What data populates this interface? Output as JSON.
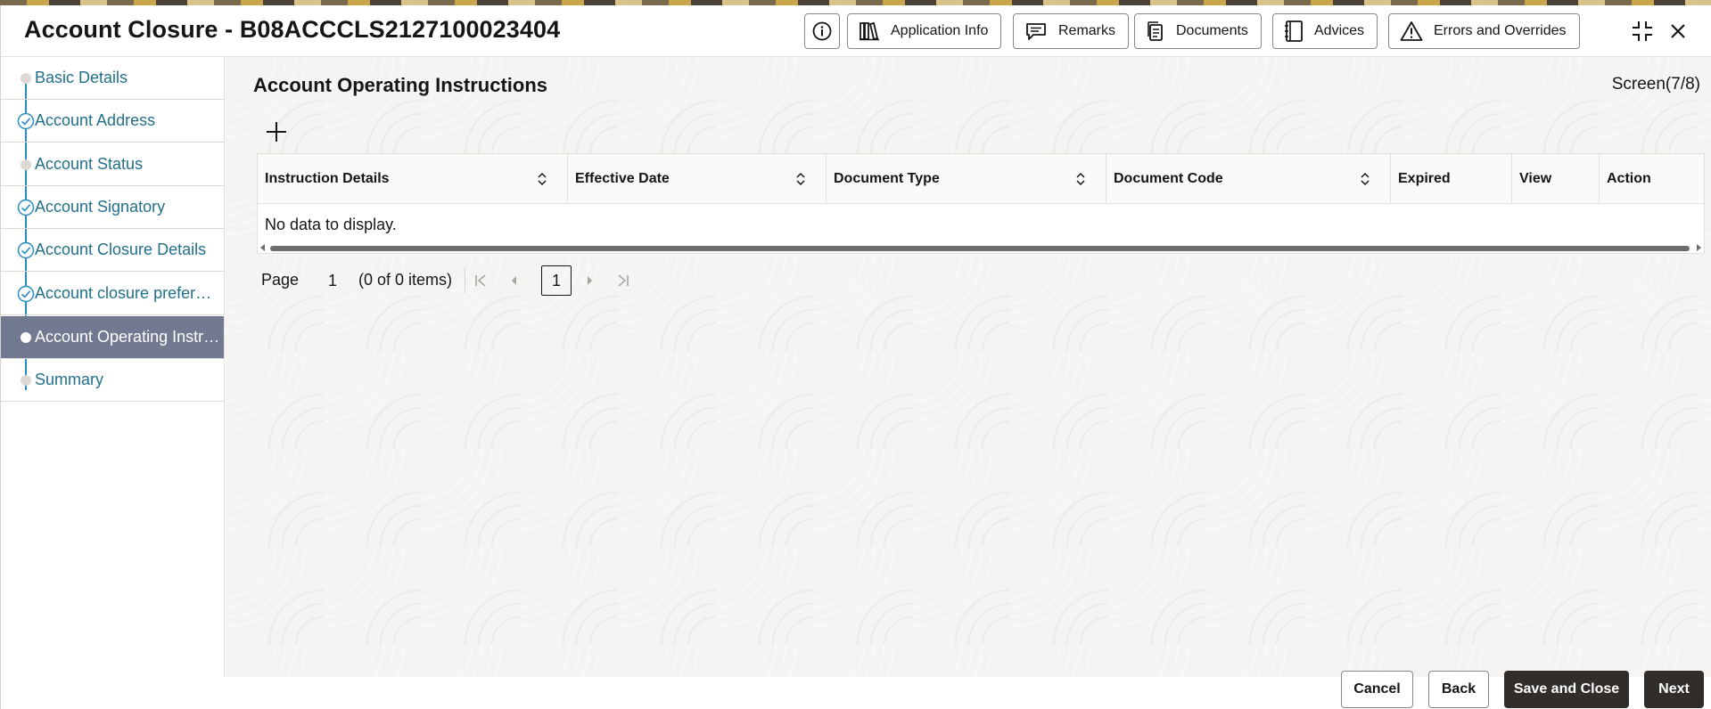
{
  "header": {
    "title": "Account Closure - B08ACCCLS2127100023404",
    "buttons": {
      "application_info": "Application Info",
      "remarks": "Remarks",
      "documents": "Documents",
      "advices": "Advices",
      "errors_overrides": "Errors and Overrides"
    }
  },
  "sidebar": {
    "items": [
      {
        "label": "Basic Details",
        "state": "pending"
      },
      {
        "label": "Account Address",
        "state": "done"
      },
      {
        "label": "Account Status",
        "state": "pending"
      },
      {
        "label": "Account Signatory",
        "state": "done"
      },
      {
        "label": "Account Closure Details",
        "state": "done"
      },
      {
        "label": "Account closure preferences",
        "state": "done"
      },
      {
        "label": "Account Operating Instructions",
        "state": "active"
      },
      {
        "label": "Summary",
        "state": "pending"
      }
    ]
  },
  "main": {
    "section_title": "Account Operating Instructions",
    "screen_counter": "Screen(7/8)",
    "table": {
      "columns": [
        "Instruction Details",
        "Effective Date",
        "Document Type",
        "Document Code",
        "Expired",
        "View",
        "Action"
      ],
      "empty_text": "No data to display."
    },
    "pager": {
      "label": "Page",
      "page_number": "1",
      "items_text": "(0 of 0 items)",
      "current": "1"
    }
  },
  "footer": {
    "cancel": "Cancel",
    "back": "Back",
    "save_close": "Save and Close",
    "next": "Next"
  },
  "colors": {
    "accent_link": "#22708a",
    "active_item_bg": "#727a92",
    "primary_button": "#312d2a",
    "progress_line": "#2a8bc5"
  }
}
